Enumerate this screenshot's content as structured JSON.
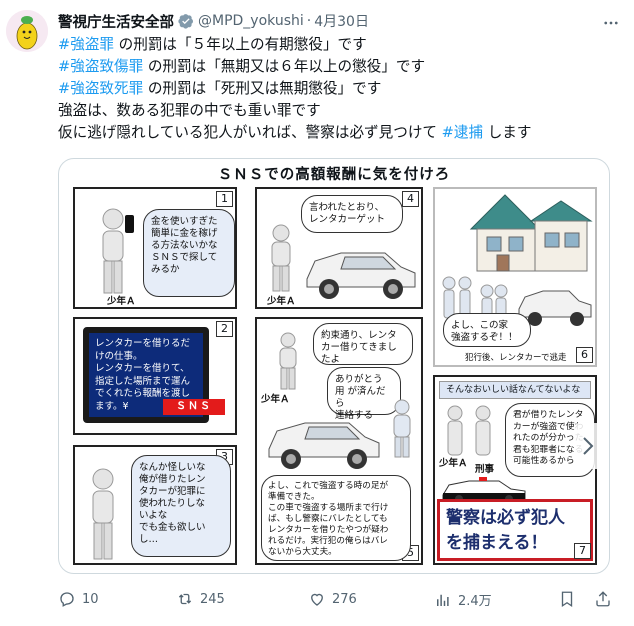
{
  "account": {
    "name": "警視庁生活安全部",
    "handle": "@MPD_yokushi",
    "separator": "·",
    "date": "4月30日"
  },
  "tweet": {
    "lines": [
      {
        "tag": "#強盗罪",
        "text": " の刑罰は「５年以上の有期懲役」です"
      },
      {
        "tag": "#強盗致傷罪",
        "text": " の刑罰は「無期又は６年以上の懲役」です"
      },
      {
        "tag": " #強盗致死罪",
        "text": " の刑罰は「死刑又は無期懲役」です"
      },
      {
        "tag": "",
        "text": "強盗は、数ある犯罪の中でも重い罪です"
      },
      {
        "tag": "",
        "text": "仮に逃げ隠れしている犯人がいれば、警察は必ず見つけて ",
        "tail_tag": "#逮捕",
        "tail_text": " します"
      }
    ]
  },
  "manga": {
    "title": "ＳＮＳでの高額報酬に気を付けろ",
    "panels": {
      "p1": {
        "num": "1",
        "bubble": "金を使いすぎた\n簡単に金を稼げ\nる方法ないかな\nＳＮＳで探して\nみるか",
        "label": "少年Ａ"
      },
      "p2": {
        "num": "2",
        "screen": "レンタカーを借りるだ\nけの仕事。\nレンタカーを借りて、\n指定した場所まで運ん\nでくれたら報酬を渡し\nます。¥",
        "sns": "ＳＮＳ"
      },
      "p3": {
        "num": "3",
        "bubble": "なんか怪しいな\n俺が借りたレン\nタカーが犯罪に\n使われたりしな\nいよな\nでも金も欲しい\nし…"
      },
      "p4": {
        "num": "4",
        "bubble": "言われたとおり、\nレンタカーゲット",
        "label": "少年Ａ"
      },
      "p5": {
        "num": "5",
        "bubble1": "約束通り、レンタ\nカー借りてきまし\nたよ",
        "bubble2": "ありがとう\n用 が済んだら\n連絡する",
        "bubble3": "よし、これで強盗する時の足が\n準備できた。\nこの車で強盗する場所まで行け\nば、もし警察にバレたとしても\nレンタカーを借りたやつが疑わ\nれるだけ。実行犯の俺らはバレ\nないから大丈夫。",
        "label": "少年Ａ"
      },
      "p6": {
        "num": "6",
        "bubble": "よし、この家\n強盗するぞ！！",
        "caption": "犯行後、レンタカーで逃走"
      },
      "p7": {
        "num": "7",
        "alert": "そんなおいしい話なんてないよな",
        "bubble": "君が借りたレンタ\nカーが強盗で使わ\nれたのが分かった\n君も犯罪者になる\n可能性あるから",
        "label_a": "少年Ａ",
        "label_b": "刑事",
        "police": "警察は必ず犯人\nを捕まえる！"
      }
    }
  },
  "actions": {
    "replies": "10",
    "retweets": "245",
    "likes": "276",
    "views": "2.4万"
  },
  "colors": {
    "link": "#1d9bf0",
    "verified": "#829aab",
    "muted": "#536471",
    "police_red": "#c81d25",
    "screen_blue": "#0d2b7a"
  },
  "icons": [
    "verified-icon",
    "more-icon",
    "reply-icon",
    "retweet-icon",
    "like-icon",
    "views-icon",
    "bookmark-icon",
    "share-icon",
    "chevron-right-icon"
  ]
}
